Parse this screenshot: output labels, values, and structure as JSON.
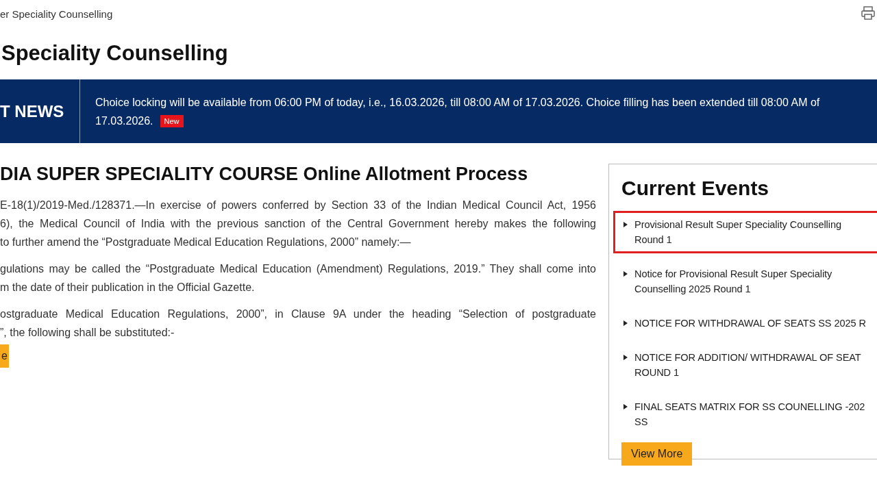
{
  "breadcrumb": "er Speciality Counselling",
  "page_title": "Speciality Counselling",
  "news": {
    "label": "T NEWS",
    "lines": [
      "Choice locking will be available from 06:00 PM of today, i.e., 16.03.2026, till 08:00 AM of 17.03.2026. Choice filling has been extended till 08:00 AM of",
      "17.03.2026."
    ],
    "badge": "New"
  },
  "main": {
    "heading": "DIA SUPER SPECIALITY COURSE Online Allotment Process",
    "paragraphs": [
      [
        "E-18(1)/2019-Med./128371.—In exercise of powers conferred by Section 33 of the Indian Medical Council Act, 1956",
        "6), the Medical Council of India with the previous sanction of the Central Government hereby makes the following",
        "to further amend the “Postgraduate Medical Education Regulations, 2000” namely:—"
      ],
      [
        "gulations may be called the “Postgraduate Medical Education (Amendment) Regulations, 2019.” They shall come into",
        "m the date of their publication in the Official Gazette."
      ],
      [
        "ostgraduate Medical Education Regulations, 2000”, in Clause 9A under the heading “Selection of postgraduate",
        "”, the following shall be substituted:-"
      ]
    ],
    "button": "e"
  },
  "events": {
    "title": "Current Events",
    "items": [
      {
        "lines": [
          "Provisional Result Super Speciality Counselling",
          "Round 1"
        ],
        "highlighted": true
      },
      {
        "lines": [
          "Notice for Provisional Result Super Speciality",
          "Counselling 2025 Round 1"
        ],
        "highlighted": false
      },
      {
        "lines": [
          "NOTICE FOR WITHDRAWAL OF SEATS SS 2025 R"
        ],
        "highlighted": false
      },
      {
        "lines": [
          "NOTICE FOR ADDITION/ WITHDRAWAL OF SEAT",
          "ROUND 1"
        ],
        "highlighted": false
      },
      {
        "lines": [
          "FINAL SEATS MATRIX FOR SS COUNELLING -202",
          "SS"
        ],
        "highlighted": false
      }
    ],
    "button": "View More"
  }
}
